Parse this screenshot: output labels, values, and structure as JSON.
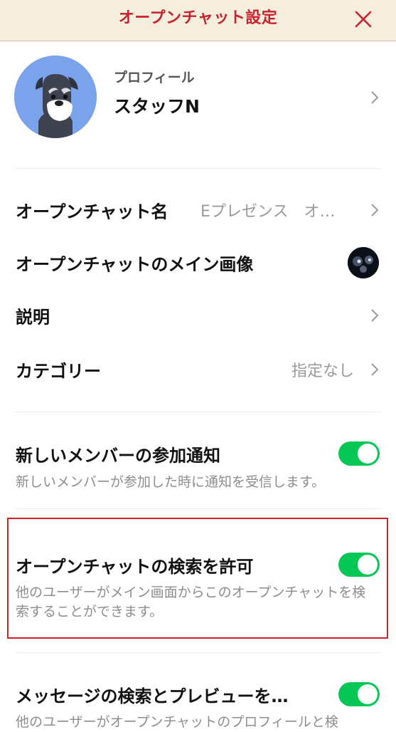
{
  "header": {
    "title": "オープンチャット設定",
    "close_icon": "close-icon",
    "title_color": "#c8222f",
    "background": "#f6eedd"
  },
  "profile": {
    "label": "プロフィール",
    "name": "スタッフN"
  },
  "settings": {
    "name": {
      "label": "オープンチャット名",
      "value": "Eプレゼンス　オ…"
    },
    "image": {
      "label": "オープンチャットのメイン画像"
    },
    "description": {
      "label": "説明"
    },
    "category": {
      "label": "カテゴリー",
      "value": "指定なし"
    }
  },
  "toggles": [
    {
      "title": "新しいメンバーの参加通知",
      "desc": "新しいメンバーが参加した時に通知を受信します。",
      "on": true
    },
    {
      "title": "オープンチャットの検索を許可",
      "desc": "他のユーザーがメイン画面からこのオープンチャットを検索することができます。",
      "on": true
    },
    {
      "title": "メッセージの検索とプレビューを…",
      "desc": "他のユーザーがオープンチャットのプロフィールと検",
      "on": true
    }
  ],
  "colors": {
    "toggle_on": "#06c755",
    "highlight_border": "#d4202a"
  }
}
